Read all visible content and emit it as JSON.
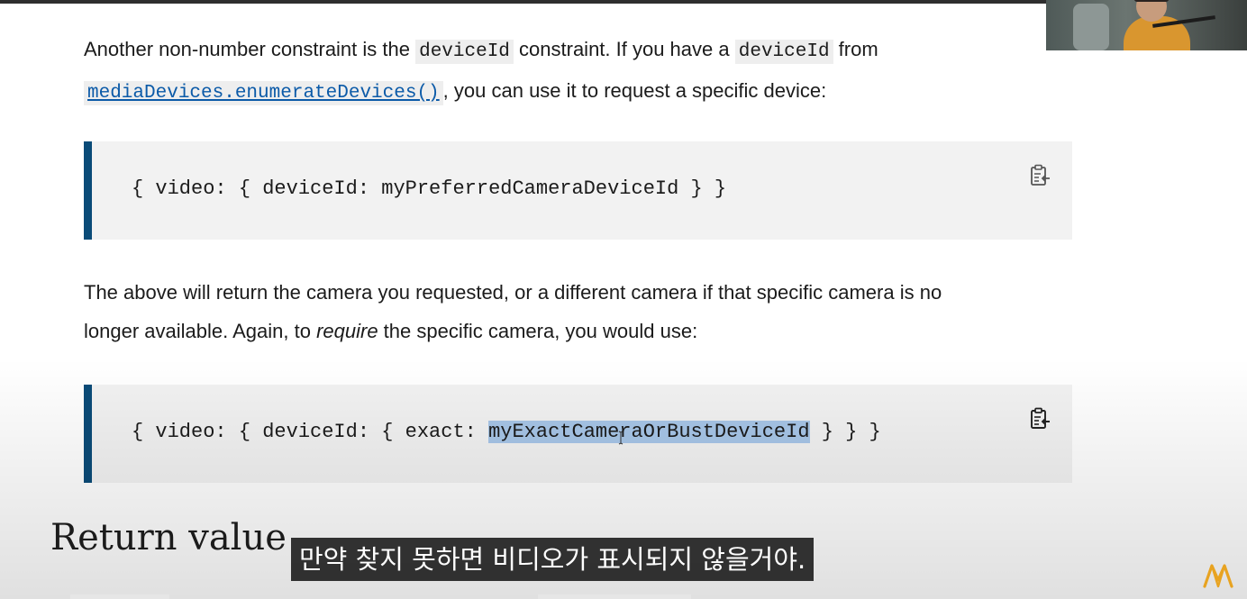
{
  "paragraph_1": {
    "text_a": "Another non-number constraint is the ",
    "code_a": "deviceId",
    "text_b": " constraint. If you have a ",
    "code_b": "deviceId",
    "text_c": " from",
    "link": "mediaDevices.enumerateDevices()",
    "text_d": ", you can use it to request a specific device:"
  },
  "code_block_1": {
    "code": "{ video: { deviceId: myPreferredCameraDeviceId } }"
  },
  "paragraph_2": {
    "text_a": "The above will return the camera you requested, or a different camera if that specific camera is no",
    "text_b": "longer available. Again, to ",
    "emphasis": "require",
    "text_c": " the specific camera, you would use:"
  },
  "code_block_2": {
    "code_before": "{ video: { deviceId: { exact: ",
    "code_selected": "myExactCameraOrBustDeviceId",
    "code_after": " } } }"
  },
  "section_heading": "Return value",
  "subtitle": "만약 찾지 못하면 비디오가 표시되지 않을거야.",
  "icons": {
    "copy": "clipboard-copy-icon",
    "brand": "brand-logo-icon"
  },
  "colors": {
    "code_border": "#0a4b78",
    "code_bg": "#f2f2f2",
    "selection": "#a7c6e8",
    "link": "#0b5aa8",
    "brand": "#e8a321"
  }
}
